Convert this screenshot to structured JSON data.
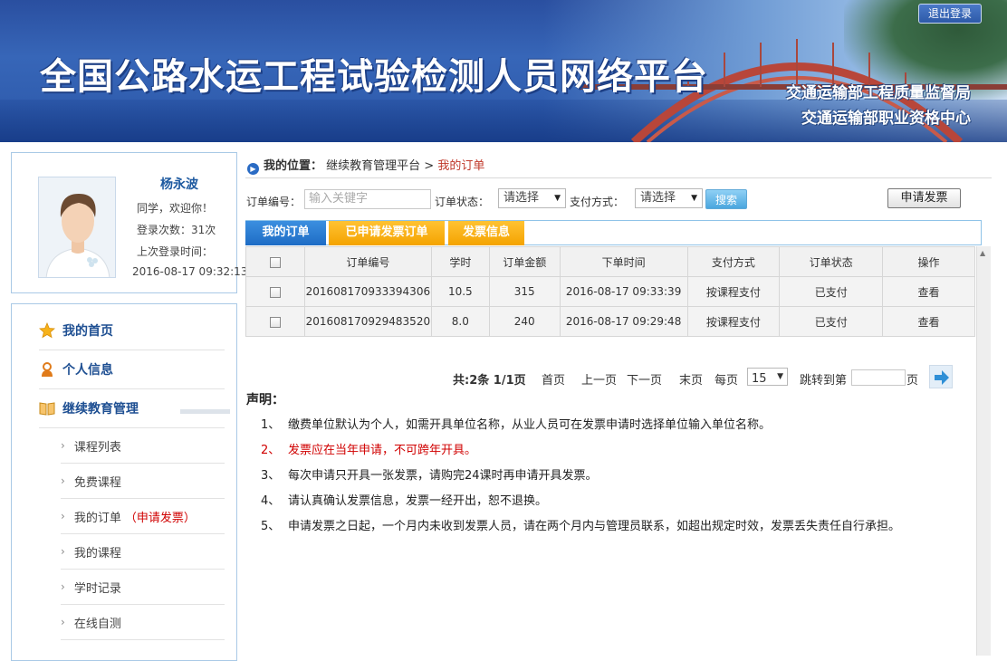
{
  "header": {
    "title": "全国公路水运工程试验检测人员网络平台",
    "org_line1": "交通运输部工程质量监督局",
    "org_line2": "交通运输部职业资格中心",
    "logout_label": "退出登录"
  },
  "user": {
    "name": "杨永波",
    "greeting": "同学，欢迎你！",
    "login_count": "登录次数：31次",
    "last_login_label": "上次登录时间：",
    "last_login_time": "2016-08-17 09:32:13"
  },
  "menu": {
    "items": [
      {
        "label": "我的首页",
        "icon": "star-icon"
      },
      {
        "label": "个人信息",
        "icon": "user-icon"
      },
      {
        "label": "继续教育管理",
        "icon": "book-icon"
      }
    ],
    "sub_items": [
      {
        "label": "课程列表"
      },
      {
        "label": "免费课程"
      },
      {
        "label": "我的订单",
        "extra": "（申请发票）"
      },
      {
        "label": "我的课程"
      },
      {
        "label": "学时记录"
      },
      {
        "label": "在线自测"
      }
    ]
  },
  "breadcrumb": {
    "prefix": "我的位置：",
    "path": "继续教育管理平台 >",
    "current": "我的订单"
  },
  "filters": {
    "order_no_label": "订单编号：",
    "order_no_placeholder": "输入关键字",
    "status_label": "订单状态：",
    "status_value": "请选择",
    "pay_label": "支付方式：",
    "pay_value": "请选择",
    "search_label": "搜索",
    "invoice_label": "申请发票"
  },
  "tabs": [
    {
      "label": "我的订单",
      "active": true
    },
    {
      "label": "已申请发票订单",
      "active": false
    },
    {
      "label": "发票信息",
      "active": false
    }
  ],
  "table": {
    "headers": [
      "订单编号",
      "学时",
      "订单金额",
      "下单时间",
      "支付方式",
      "订单状态",
      "操作"
    ],
    "rows": [
      {
        "order_no": "201608170933394306",
        "hours": "10.5",
        "amount": "315",
        "time": "2016-08-17 09:33:39",
        "pay": "按课程支付",
        "status": "已支付",
        "action": "查看"
      },
      {
        "order_no": "201608170929483520",
        "hours": "8.0",
        "amount": "240",
        "time": "2016-08-17 09:29:48",
        "pay": "按课程支付",
        "status": "已支付",
        "action": "查看"
      }
    ]
  },
  "pager": {
    "total": "共:2条  1/1页",
    "first": "首页",
    "prev": "上一页",
    "next": "下一页",
    "last": "末页",
    "per_page_label": "每页",
    "per_page_value": "15",
    "goto_label": "跳转到第",
    "page_suffix": "页"
  },
  "notice": {
    "title": "声明：",
    "items": [
      {
        "num": "1、",
        "text": "缴费单位默认为个人，如需开具单位名称，从业人员可在发票申请时选择单位输入单位名称。"
      },
      {
        "num": "2、",
        "text": "发票应在当年申请，不可跨年开具。"
      },
      {
        "num": "3、",
        "text": "每次申请只开具一张发票，请购完24课时再申请开具发票。"
      },
      {
        "num": "4、",
        "text": "请认真确认发票信息，发票一经开出，恕不退换。"
      },
      {
        "num": "5、",
        "text": "申请发票之日起，一个月内未收到发票人员，请在两个月内与管理员联系，如超出规定时效，发票丢失责任自行承担。"
      }
    ]
  },
  "colors": {
    "banner_blue": "#2b57a8",
    "link_blue": "#1e4f92",
    "tab_active": "#1e6cc5",
    "tab_inactive": "#f4a300",
    "warning_red": "#d00000"
  }
}
